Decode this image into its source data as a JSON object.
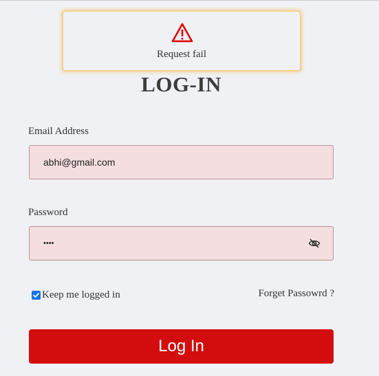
{
  "alert": {
    "icon": "warning-triangle-icon",
    "message": "Request fail",
    "icon_color": "#e00000",
    "border_color": "#f4cf8d"
  },
  "page_title": "LOG-IN",
  "email": {
    "label": "Email Address",
    "value": "abhi@gmail.com"
  },
  "password": {
    "label": "Password",
    "value": "••••",
    "toggle_icon": "eye-slash-icon"
  },
  "remember_me": {
    "label": "Keep me logged in",
    "checked": true
  },
  "forgot_password": "Forget Passowrd ?",
  "login_button": {
    "label": "Log In",
    "color": "#d30d0d"
  }
}
